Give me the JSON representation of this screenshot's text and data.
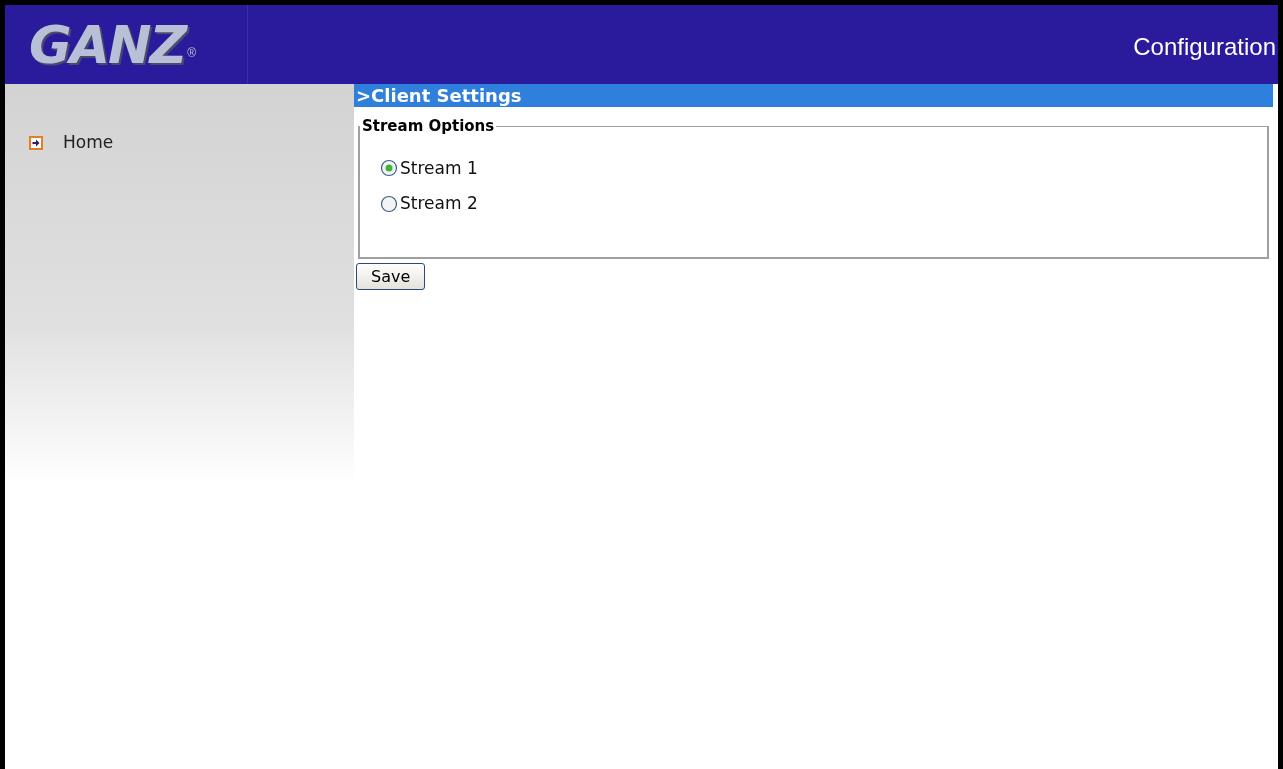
{
  "header": {
    "logo": "GANZ",
    "logo_mark": "®",
    "title": "Configuration"
  },
  "sidebar": {
    "items": [
      {
        "label": "Home"
      }
    ]
  },
  "section_title": ">Client Settings",
  "stream_options": {
    "legend": "Stream Options",
    "options": [
      {
        "label": "Stream 1",
        "selected": true
      },
      {
        "label": "Stream 2",
        "selected": false
      }
    ]
  },
  "buttons": [
    "Save"
  ]
}
